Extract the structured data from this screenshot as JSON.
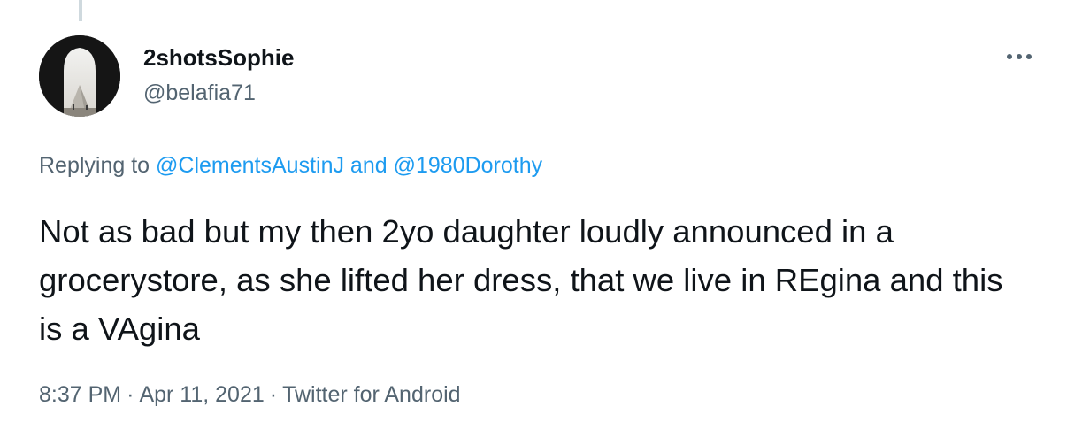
{
  "author": {
    "display_name": "2shotsSophie",
    "handle": "@belafia71"
  },
  "reply_context": {
    "prefix": "Replying to ",
    "mention_1": "@ClementsAustinJ",
    "conjunction": " and ",
    "mention_2": "@1980Dorothy"
  },
  "tweet": {
    "text": "Not as bad but my then 2yo daughter loudly announced in a grocerystore, as she lifted her dress, that we live in REgina and this is a VAgina"
  },
  "meta": {
    "time": "8:37 PM",
    "separator": "·",
    "date": "Apr 11, 2021",
    "source": "Twitter for Android"
  },
  "icons": {
    "more": "more-horizontal-icon"
  },
  "colors": {
    "text": "#0f1419",
    "secondary": "#536471",
    "link": "#1d9bf0",
    "thread_line": "#cfd9de"
  }
}
